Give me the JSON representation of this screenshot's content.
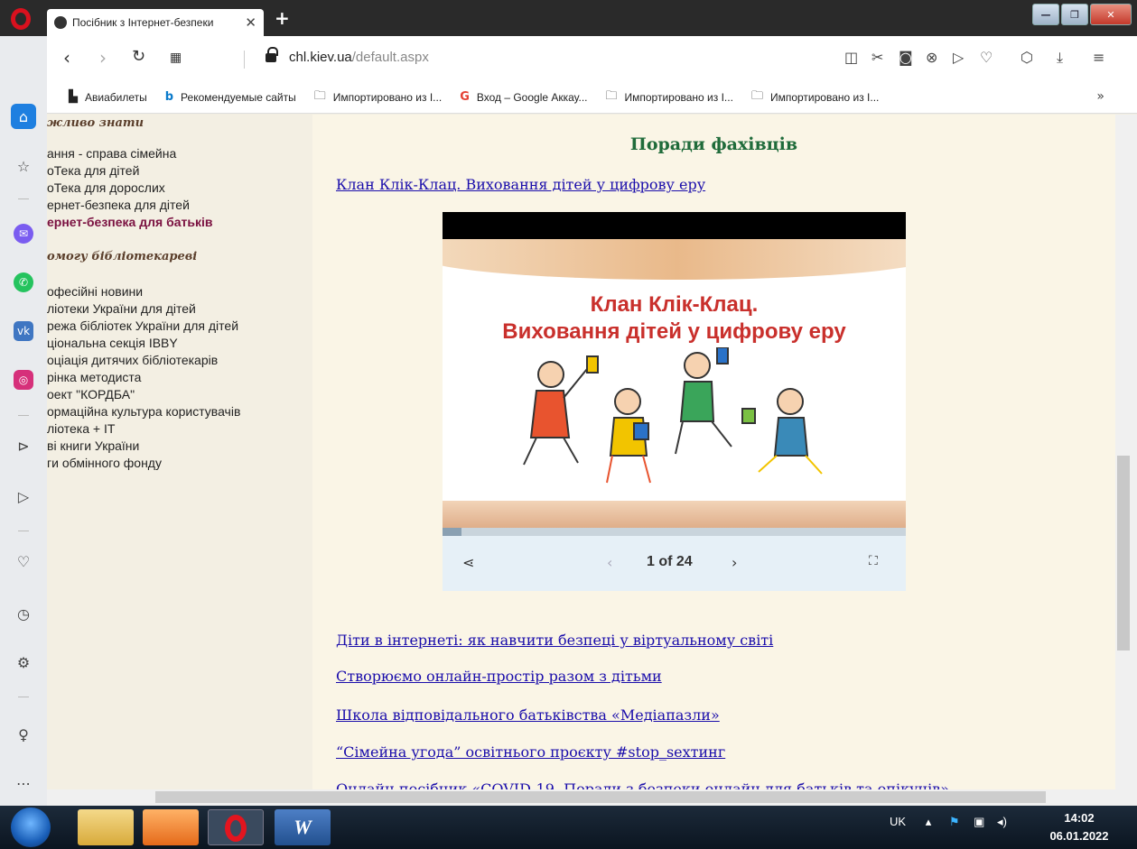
{
  "browser": {
    "tab_title": "Посібник з Інтернет-безпеки",
    "url_host": "chl.kiev.ua",
    "url_path": "/default.aspx",
    "new_tab": "+"
  },
  "bookmarks": [
    {
      "label": "Авиабилеты"
    },
    {
      "label": "Рекомендуемые сайты"
    },
    {
      "label": "Импортировано из I..."
    },
    {
      "label": "Вход – Google Аккау..."
    },
    {
      "label": "Импортировано из I..."
    },
    {
      "label": "Импортировано из I..."
    }
  ],
  "leftnav": {
    "heading_top": "жливо знати",
    "items_a": [
      "ання - справа сімейна",
      "оТека для дітей",
      "оТека для дорослих",
      "ернет-безпека для дітей",
      "ернет-безпека для батьків"
    ],
    "heading_mid": "омогу бібліотекареві",
    "items_b": [
      "офесійні новини",
      "ліотеки України для дітей",
      "режа бібліотек України для дітей",
      "ціональна секція IBBY",
      "оціація дитячих бібліотекарів",
      "рінка методиста",
      "оект \"КОРДБА\"",
      "ормаційна культура користувачів",
      "ліотека + IT",
      "ві книги України",
      "ги обмінного фонду"
    ]
  },
  "content": {
    "heading": "Поради фахівців",
    "link_top": "Клан Клік-Клац. Виховання дітей у цифрову еру",
    "links": [
      "Діти в інтернеті: як навчити безпеці у віртуальному світі",
      "Створюємо онлайн-простір разом з дітьми",
      "Школа відповідального батьківства «Медіапазли»",
      "“Сімейна угода” освітнього проєкту #stop_sexтинг",
      "Онлайн посібник «COVID-19. Поради з безпеки онлайн для батьків та опікунів»"
    ]
  },
  "slideshow": {
    "title_line1": "Клан Клік-Клац.",
    "title_line2": "Виховання дітей у цифрову еру",
    "counter": "1 of 24",
    "progress": 0.04
  },
  "taskbar": {
    "lang": "UK",
    "time": "14:02",
    "date": "06.01.2022"
  },
  "colors": {
    "heading": "#1f6b3a",
    "link": "#1a0dab",
    "active_nav": "#7a1040",
    "slide_title": "#c9302c"
  }
}
